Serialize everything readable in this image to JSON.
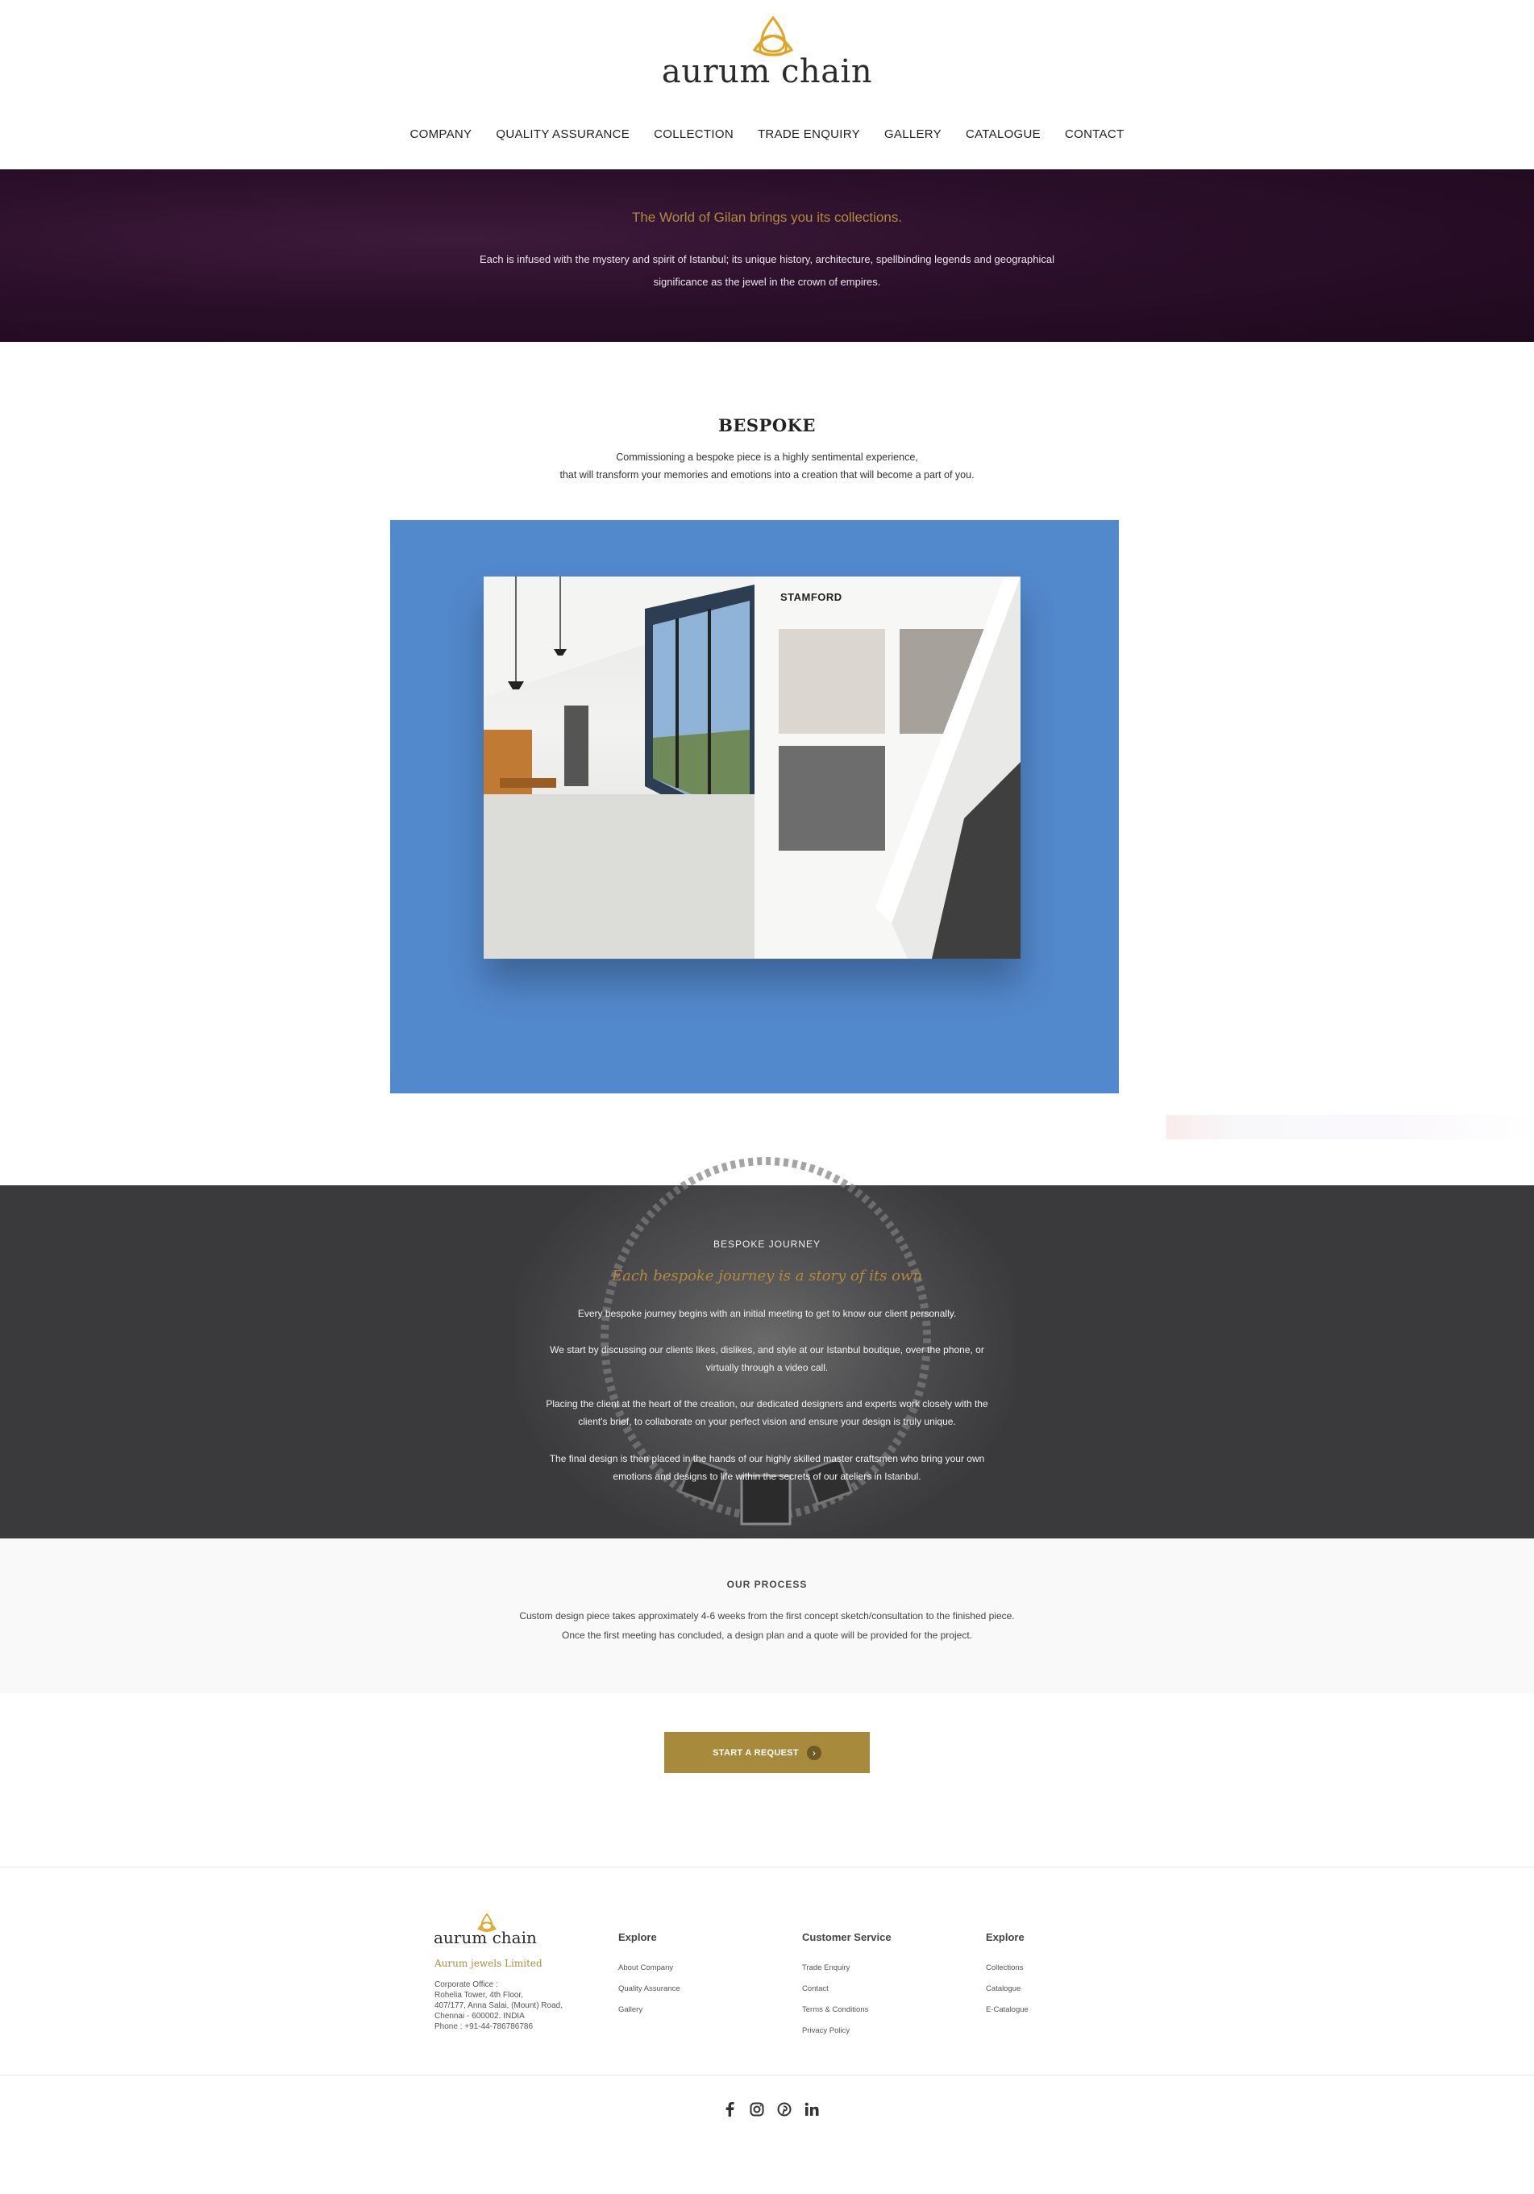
{
  "brand": {
    "name": "aurum chain",
    "accent": "#b28a3d",
    "logo_icon": "triquetra-icon"
  },
  "nav": {
    "items": [
      {
        "label": "COMPANY"
      },
      {
        "label": "QUALITY ASSURANCE"
      },
      {
        "label": "COLLECTION"
      },
      {
        "label": "TRADE ENQUIRY"
      },
      {
        "label": "GALLERY"
      },
      {
        "label": "CATALOGUE"
      },
      {
        "label": "CONTACT"
      }
    ]
  },
  "hero": {
    "title": "The World of Gilan brings you its collections.",
    "body": "Each is infused with the mystery and spirit of Istanbul; its unique history, architecture, spellbinding legends and geographical significance as the jewel in the crown of empires.",
    "background": "#2b0f2a"
  },
  "bespoke": {
    "title": "BESPOKE",
    "line1": "Commissioning a bespoke piece is a highly sentimental experience,",
    "line2": "that will transform your memories and emotions into a creation that will become a part of you.",
    "catalog_bg": "#5288cc",
    "book_heading": "STAMFORD"
  },
  "journey": {
    "kicker": "BESPOKE JOURNEY",
    "title": "Each bespoke journey is a story of its own",
    "p1": "Every bespoke journey begins with an initial meeting to get to know our client personally.",
    "p2": "We start by discussing our clients likes, dislikes, and style at our Istanbul boutique, over the phone, or virtually through a video call.",
    "p3": "Placing the client at the heart of the creation, our dedicated designers and experts work closely with the client's brief, to collaborate on your perfect vision and ensure your design is truly unique.",
    "p4": "The final design is then placed in the hands of our highly skilled master craftsmen who bring your own emotions and designs to life within the secrets of our ateliers in Istanbul."
  },
  "process": {
    "title": "OUR PROCESS",
    "line1": "Custom design piece takes approximately 4-6 weeks from the first concept sketch/consultation to the finished piece.",
    "line2": "Once the first meeting has concluded, a design plan and a quote will be provided for the project."
  },
  "cta": {
    "label": "START A REQUEST",
    "color": "#a78a3c",
    "icon": "chevron-right-icon"
  },
  "footer": {
    "logo_text": "aurum chain",
    "company": "Aurum jewels Limited",
    "address": [
      "Corporate Office :",
      "Rohelia Tower, 4th Floor,",
      "407/177, Anna Salai, (Mount) Road,",
      "Chennai - 600002. INDIA",
      "Phone : +91-44-786786786"
    ],
    "columns": [
      {
        "heading": "Explore",
        "links": [
          "About Company",
          "Quality Assurance",
          "Gallery"
        ]
      },
      {
        "heading": "Customer Service",
        "links": [
          "Trade Enquiry",
          "Contact",
          "Terms & Conditions",
          "Privacy Policy"
        ]
      },
      {
        "heading": "Explore",
        "links": [
          "Collections",
          "Catalogue",
          "E-Catalogue"
        ]
      }
    ],
    "social": [
      "facebook-icon",
      "instagram-icon",
      "pinterest-icon",
      "linkedin-icon"
    ]
  }
}
